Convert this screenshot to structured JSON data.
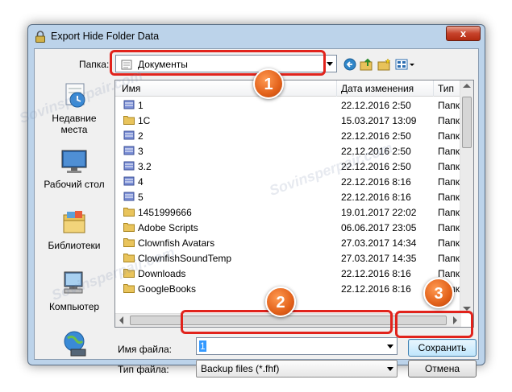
{
  "window": {
    "title": "Export Hide Folder Data",
    "close_glyph": "x"
  },
  "toolbar": {
    "lookin_label": "Папка:",
    "lookin_value": "Документы"
  },
  "places": [
    {
      "line1": "Недавние",
      "line2": "места",
      "icon": "recent-places-icon"
    },
    {
      "line1": "Рабочий стол",
      "line2": "",
      "icon": "desktop-icon"
    },
    {
      "line1": "Библиотеки",
      "line2": "",
      "icon": "libraries-icon"
    },
    {
      "line1": "Компьютер",
      "line2": "",
      "icon": "computer-icon"
    },
    {
      "line1": "",
      "line2": "",
      "icon": "network-icon"
    }
  ],
  "columns": {
    "name": "Имя",
    "date": "Дата изменения",
    "type": "Тип"
  },
  "files": [
    {
      "name": "1",
      "date": "22.12.2016 2:50",
      "type": "Папка",
      "icon": "library-folder"
    },
    {
      "name": "1C",
      "date": "15.03.2017 13:09",
      "type": "Папка",
      "icon": "folder"
    },
    {
      "name": "2",
      "date": "22.12.2016 2:50",
      "type": "Папка",
      "icon": "library-folder"
    },
    {
      "name": "3",
      "date": "22.12.2016 2:50",
      "type": "Папка",
      "icon": "library-folder"
    },
    {
      "name": "3.2",
      "date": "22.12.2016 2:50",
      "type": "Папка",
      "icon": "library-folder"
    },
    {
      "name": "4",
      "date": "22.12.2016 8:16",
      "type": "Папка",
      "icon": "library-folder"
    },
    {
      "name": "5",
      "date": "22.12.2016 8:16",
      "type": "Папка",
      "icon": "library-folder"
    },
    {
      "name": "1451999666",
      "date": "19.01.2017 22:02",
      "type": "Папка",
      "icon": "folder"
    },
    {
      "name": "Adobe Scripts",
      "date": "06.06.2017 23:05",
      "type": "Папка",
      "icon": "folder"
    },
    {
      "name": "Clownfish Avatars",
      "date": "27.03.2017 14:34",
      "type": "Папка",
      "icon": "folder"
    },
    {
      "name": "ClownfishSoundTemp",
      "date": "27.03.2017 14:35",
      "type": "Папка",
      "icon": "folder"
    },
    {
      "name": "Downloads",
      "date": "22.12.2016 8:16",
      "type": "Папка",
      "icon": "folder"
    },
    {
      "name": "GoogleBooks",
      "date": "22.12.2016 8:16",
      "type": "Папка",
      "icon": "folder"
    }
  ],
  "filename": {
    "label": "Имя файла:",
    "value": "1"
  },
  "filetype": {
    "label": "Тип файла:",
    "value": "Backup files (*.fhf)"
  },
  "buttons": {
    "save": "Сохранить",
    "cancel": "Отмена"
  },
  "markers": [
    "1",
    "2",
    "3"
  ],
  "watermark": "Sovinsperpair.com",
  "colors": {
    "marker": "#e1231c",
    "badge": "#e2611a"
  }
}
